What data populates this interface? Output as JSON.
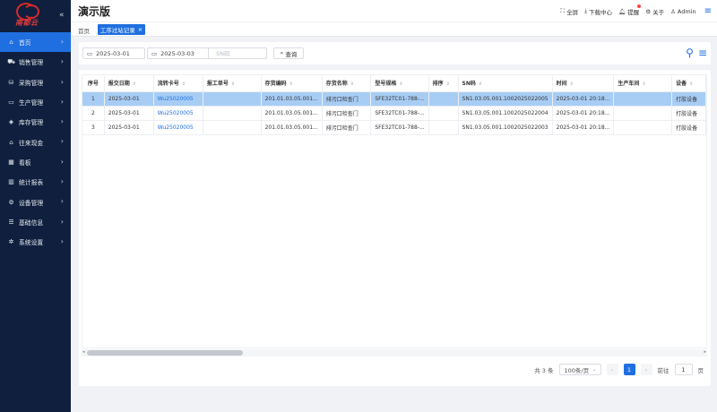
{
  "app": {
    "title": "演示版",
    "logo_text": "南都云"
  },
  "header": {
    "fullscreen": "全屏",
    "download": "下载中心",
    "reminder": "提醒",
    "about": "关于",
    "user": "Admin"
  },
  "sidebar": {
    "items": [
      {
        "label": "首页",
        "icon": "home-icon",
        "active": true
      },
      {
        "label": "销售管理",
        "icon": "truck-icon"
      },
      {
        "label": "采购管理",
        "icon": "cart-icon"
      },
      {
        "label": "生产管理",
        "icon": "monitor-icon"
      },
      {
        "label": "库存管理",
        "icon": "box-icon"
      },
      {
        "label": "往来现金",
        "icon": "bank-icon"
      },
      {
        "label": "看板",
        "icon": "board-icon"
      },
      {
        "label": "统计报表",
        "icon": "bar-chart-icon"
      },
      {
        "label": "设备管理",
        "icon": "gear-icon"
      },
      {
        "label": "基础信息",
        "icon": "sliders-icon"
      },
      {
        "label": "系统设置",
        "icon": "cog-icon"
      }
    ]
  },
  "tabs": {
    "home": "首页",
    "active": "工序过站记录"
  },
  "search": {
    "date_start": "2025-03-01",
    "date_end": "2025-03-03",
    "sn_placeholder": "SN码",
    "query_label": "查询"
  },
  "table": {
    "columns": [
      "序号",
      "报交日期",
      "流转卡号",
      "报工单号",
      "存货编码",
      "存货名称",
      "型号规格",
      "排序",
      "SN码",
      "时间",
      "生产车间",
      "设备"
    ],
    "rows": [
      [
        "1",
        "2025-03-01",
        "Wu25020005",
        "",
        "201.01.03.05.001...",
        "排污口检查门",
        "SFE32TC01-788-...",
        "",
        "SN1.03.05.001.1002025022005",
        "2025-03-01 20:18...",
        "",
        "打胶设备"
      ],
      [
        "2",
        "2025-03-01",
        "Wu25020005",
        "",
        "201.01.03.05.001...",
        "排污口检查门",
        "SFE32TC01-788-...",
        "",
        "SN1.03.05.001.1002025022004",
        "2025-03-01 20:18...",
        "",
        "打胶设备"
      ],
      [
        "3",
        "2025-03-01",
        "Wu25020005",
        "",
        "201.01.03.05.001...",
        "排污口检查门",
        "SFE32TC01-788-...",
        "",
        "SN1.03.05.001.1002025022003",
        "2025-03-01 20:18...",
        "",
        "打胶设备"
      ]
    ],
    "selected_row": 0
  },
  "pagination": {
    "total": "共 3 条",
    "page_size": "100条/页",
    "current_page": "1",
    "goto_label": "前往",
    "goto_value": "1",
    "page_unit": "页"
  },
  "colors": {
    "accent": "#1f6fe0",
    "sidebar_bg": "#0f1f3d",
    "selected_row": "#a8cdf5"
  }
}
